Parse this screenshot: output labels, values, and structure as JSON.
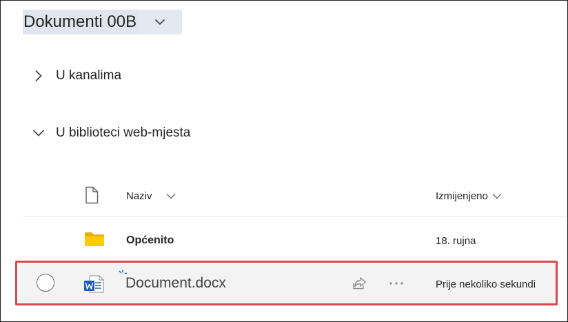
{
  "library": {
    "title": "Dokumenti 00B",
    "dropdown_icon": "chevron-down-icon"
  },
  "sections": {
    "channels": {
      "label": "U kanalima",
      "expanded": false
    },
    "site_library": {
      "label": "U biblioteci web-mjesta",
      "expanded": true
    }
  },
  "table": {
    "columns": {
      "file_type_icon": "document-outline-icon",
      "name": "Naziv",
      "modified": "Izmijenjeno"
    },
    "rows": [
      {
        "type": "folder",
        "icon": "folder-icon",
        "name": "Općenito",
        "modified": "18. rujna"
      },
      {
        "type": "word-document",
        "icon": "word-icon",
        "name": "Document.docx",
        "modified": "Prije nekoliko sekundi",
        "new_indicator": true
      }
    ]
  },
  "colors": {
    "highlight_border": "#d9464b",
    "folder": "#f5c400",
    "word_blue": "#185abd",
    "title_bg": "#e1e5ed",
    "new_badge": "#0f6cbd"
  }
}
